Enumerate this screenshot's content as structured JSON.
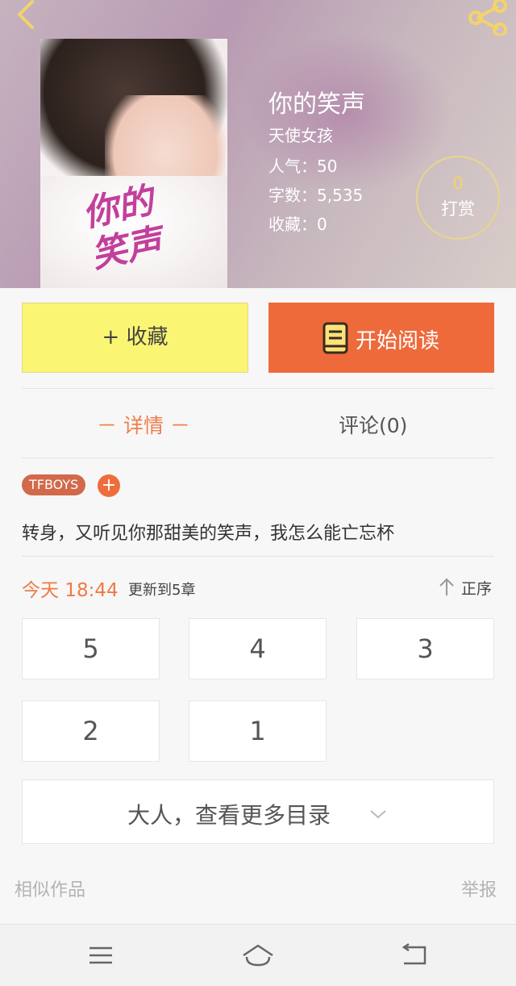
{
  "book": {
    "title": "你的笑声",
    "author": "天使女孩",
    "popularity": "人气：50",
    "word_count": "字数：5,535",
    "favorites": "收藏：0",
    "cover_title": "你的笑声"
  },
  "tip": {
    "count": "0",
    "label": "打赏"
  },
  "actions": {
    "favorite_label": "+ 收藏",
    "read_label": "开始阅读"
  },
  "tabs": [
    {
      "label": "－ 详情 －",
      "active": true
    },
    {
      "label": "评论(0)",
      "active": false
    }
  ],
  "tags": [
    {
      "label": "TFBOYS"
    }
  ],
  "tag_add": "+",
  "description": "转身，又听见你那甜美的笑声，我怎么能亡忘杯",
  "update": {
    "time": "今天 18:44",
    "text": "更新到5章",
    "sort_label": "正序"
  },
  "chapters": [
    "5",
    "4",
    "3",
    "2",
    "1"
  ],
  "more_chapters_label": "大人，查看更多目录",
  "footer": {
    "similar": "相似作品",
    "report": "举报"
  },
  "colors": {
    "accent": "#ee6a3b",
    "favorite_bg": "#faf573",
    "tag": "#d2694a",
    "orange_text": "#ef7a44"
  },
  "icons": [
    "back-icon",
    "share-icon",
    "book-icon",
    "sort-arrow-icon",
    "chevron-down-icon",
    "menu-icon",
    "home-icon",
    "return-icon"
  ]
}
